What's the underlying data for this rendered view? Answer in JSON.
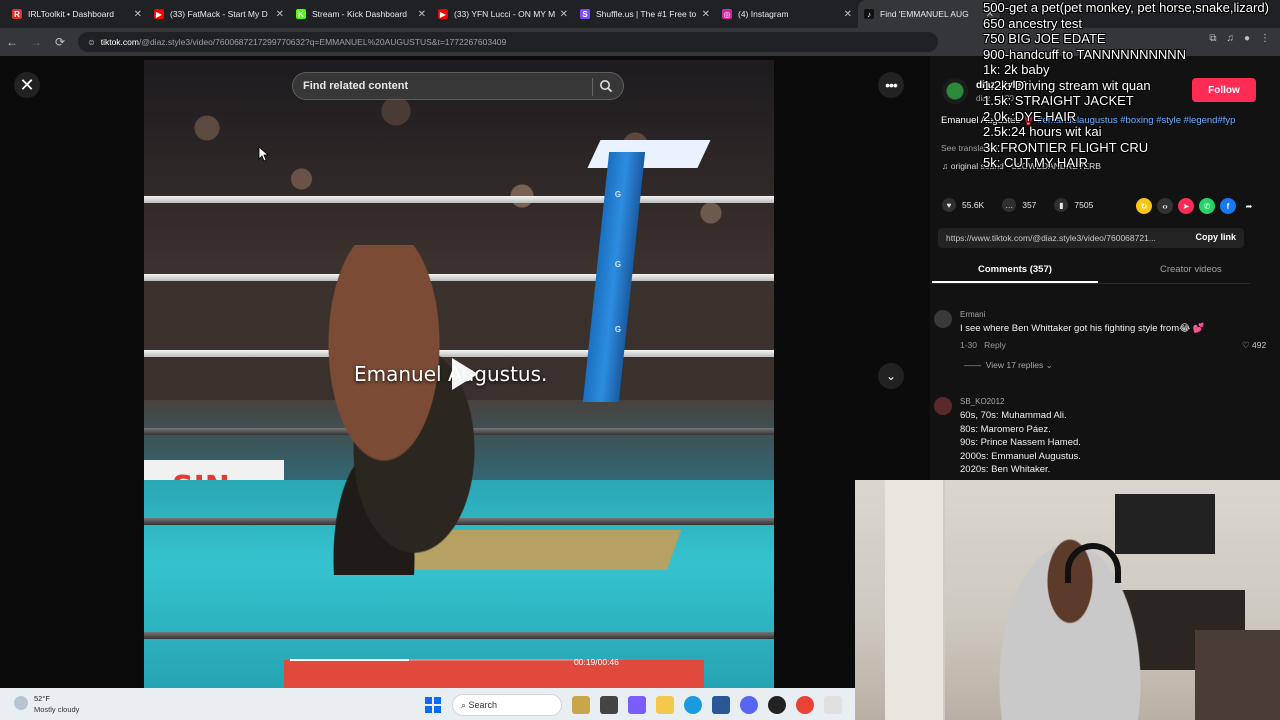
{
  "browser": {
    "tabs": [
      {
        "title": "IRLToolkit • Dashboard",
        "color": "#e02f2f",
        "letter": "R"
      },
      {
        "title": "(33) FatMack - Start My D",
        "color": "#ff0000",
        "letter": "▶"
      },
      {
        "title": "Stream - Kick Dashboard",
        "color": "#53fc18",
        "letter": "K"
      },
      {
        "title": "(33) YFN Lucci - ON MY M",
        "color": "#ff0000",
        "letter": "▶"
      },
      {
        "title": "Shuffle.us | The #1 Free to",
        "color": "#7c4dff",
        "letter": "S"
      },
      {
        "title": "(4) Instagram",
        "color": "#d6249f",
        "letter": "◎"
      },
      {
        "title": "Find 'EMMANUEL AUG",
        "color": "#111111",
        "letter": "♪",
        "active": true
      }
    ],
    "url_host": "tiktok.com",
    "url_rest": "/@diaz.style3/video/7600687217299770632?q=EMMANUEL%20AUGUSTUS&t=1772267603409"
  },
  "video": {
    "search_placeholder": "Find related content",
    "caption": "Emanuel Augustus.",
    "time": "00:19/00:46",
    "progress_fraction": 0.41,
    "ad_text": "SIN",
    "post_labels": [
      "G",
      "G",
      "G"
    ]
  },
  "panel": {
    "author_name": "diaz.style3",
    "author_sub": "diaz · 1-30",
    "follow_label": "Follow",
    "description_plain": "Emanuel Augustus 🥊 ",
    "hashtags": [
      "#emanuelaugustus",
      "#boxing",
      "#style",
      "#legend",
      "#fyp"
    ],
    "see_translation": "See translation",
    "sound": "original sound - SLOWEDANDREVERB",
    "likes": "55.6K",
    "comments": "357",
    "saves": "7505",
    "share_link": "https://www.tiktok.com/@diaz.style3/video/760068721...",
    "copy_label": "Copy link",
    "tab_comments": "Comments (357)",
    "tab_creator": "Creator videos",
    "comments_list": [
      {
        "user": "Ermani",
        "text": "I see where Ben Whittaker got his fighting style from😂 💕",
        "date": "1-30",
        "reply": "Reply",
        "likes": "492",
        "replies": "View 17 replies"
      },
      {
        "user": "SB_KO2012",
        "text": "60s, 70s: Muhammad Ali.\n80s: Maromero Páez.\n90s: Prince Nassem Hamed.\n2000s: Emmanuel Augustus.\n2020s: Ben Whitaker."
      }
    ]
  },
  "overlay": [
    "500-get a pet(pet monkey, pet horse,snake,lizard)",
    "650 ancestry test",
    "750 BIG JOE EDATE",
    "900-handcuff to TANNNNNNNNNN",
    "1k: 2k baby",
    "1.2k: Driving stream wit quan",
    "1.5k: STRAIGHT JACKET",
    "2.0k :DYE HAIR",
    "2.5k:24 hours wit kai",
    "3k:FRONTIER FLIGHT CRU",
    "5k: CUT MY HAIR"
  ],
  "taskbar": {
    "temp": "52°F",
    "weather": "Mostly cloudy",
    "search": "Search"
  }
}
